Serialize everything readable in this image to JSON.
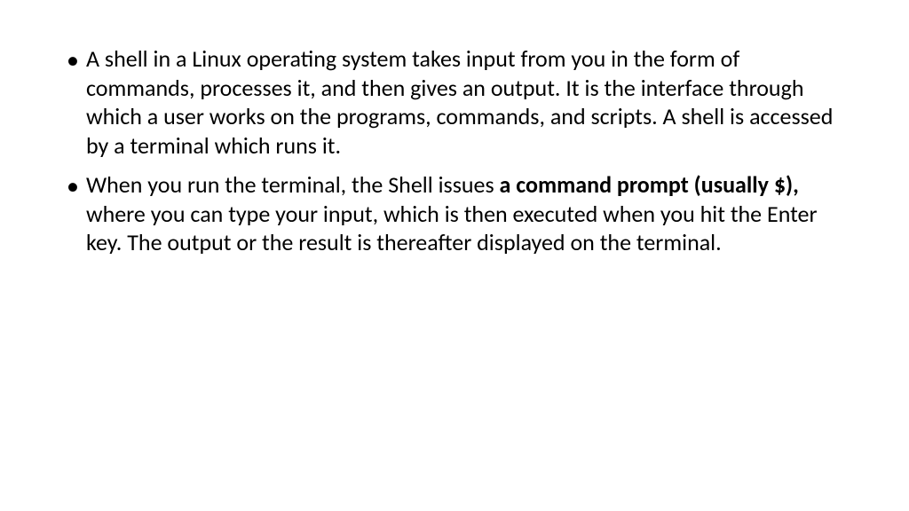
{
  "bullets": [
    {
      "text": "A shell in a Linux operating system takes input from you in the form of commands, processes it, and then gives an output. It is the interface through which a user works on the programs, commands, and scripts. A shell is accessed by a terminal which runs it."
    },
    {
      "prefix": "When you run the terminal, the Shell issues ",
      "bold": "a command prompt (usually $), ",
      "suffix": "where you can type your input, which is then executed when you hit the Enter key. The output or the result is thereafter displayed on the terminal."
    }
  ]
}
